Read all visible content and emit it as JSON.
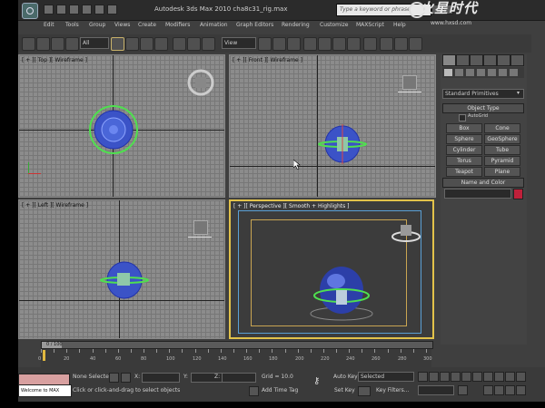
{
  "window": {
    "title": "Autodesk 3ds Max  2010      cha8c31_rig.max",
    "search_placeholder": "Type a keyword or phrase"
  },
  "watermark": {
    "brand": "火星时代",
    "url": "www.hxsd.com"
  },
  "menu": [
    "Edit",
    "Tools",
    "Group",
    "Views",
    "Create",
    "Modifiers",
    "Animation",
    "Graph Editors",
    "Rendering",
    "Customize",
    "MAXScript",
    "Help"
  ],
  "toolbar": {
    "selection_filter": "All",
    "reference_coord": "View"
  },
  "viewports": {
    "top": "[ + ][ Top ][ Wireframe ]",
    "front": "[ + ][ Front ][ Wireframe ]",
    "left": "[ + ][ Left ][ Wireframe ]",
    "perspective": "[ + ][ Perspective ][ Smooth + Highlights ]"
  },
  "command_panel": {
    "category": "Standard Primitives",
    "object_type_title": "Object Type",
    "autogrid": "AutoGrid",
    "buttons": [
      "Box",
      "Cone",
      "Sphere",
      "GeoSphere",
      "Cylinder",
      "Tube",
      "Torus",
      "Pyramid",
      "Teapot",
      "Plane"
    ],
    "name_color_title": "Name and Color",
    "color": "#c0203a"
  },
  "timeline": {
    "frame_label": "0 / 100",
    "ticks": [
      "0",
      "10",
      "20",
      "30",
      "40",
      "50",
      "60",
      "70",
      "80",
      "90",
      "100",
      "110",
      "120",
      "130",
      "140",
      "150",
      "160",
      "170",
      "180",
      "190",
      "200",
      "210",
      "220",
      "230",
      "240",
      "250",
      "260",
      "270",
      "280",
      "290",
      "300"
    ]
  },
  "status": {
    "maxscript": "Welcome to MAX",
    "selection": "None Selected",
    "prompt": "Click or click-and-drag to select objects",
    "x_label": "X:",
    "y_label": "Y:",
    "z_label": "Z:",
    "grid": "Grid = 10.0",
    "add_time_tag": "Add Time Tag",
    "auto_key": "Auto Key",
    "set_key": "Set Key",
    "selected": "Selected",
    "key_filters": "Key Filters..."
  }
}
